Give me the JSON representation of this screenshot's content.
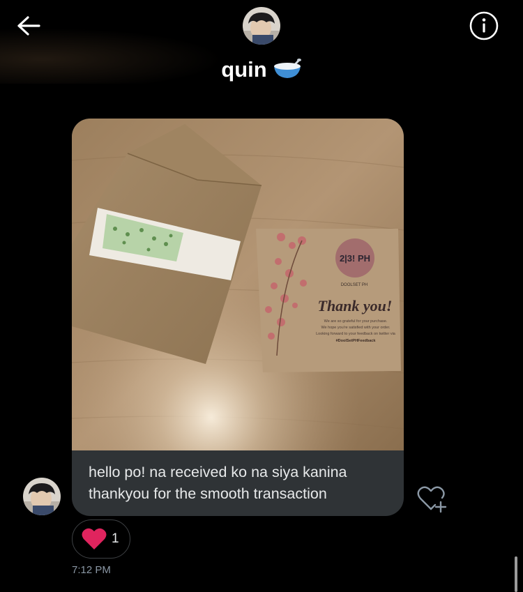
{
  "header": {
    "contact_name": "quin",
    "name_emoji": "🥣",
    "back_icon": "arrow-left-icon",
    "info_icon": "info-circle-icon"
  },
  "message": {
    "text_line1": "hello po! na received ko na siya kanina",
    "text_line2": "thankyou for the smooth transaction",
    "photo_card": {
      "title": "Thank you!",
      "line1": "We are so grateful for your purchase.",
      "line2": "We hope you're satisfied with your order.",
      "line3": "Looking forward to your feedback on twitter via",
      "hashtag": "#DoolSetPHFeedback",
      "brand": "DOOLSET PH"
    },
    "reaction": {
      "emoji": "heart-icon",
      "count": "1"
    },
    "timestamp": "7:12 PM",
    "add_reaction_icon": "heart-plus-icon"
  },
  "colors": {
    "background": "#000000",
    "bubble": "#2f3336",
    "text": "#e7e9ea",
    "muted": "#8b98a5",
    "heart": "#f91880"
  }
}
